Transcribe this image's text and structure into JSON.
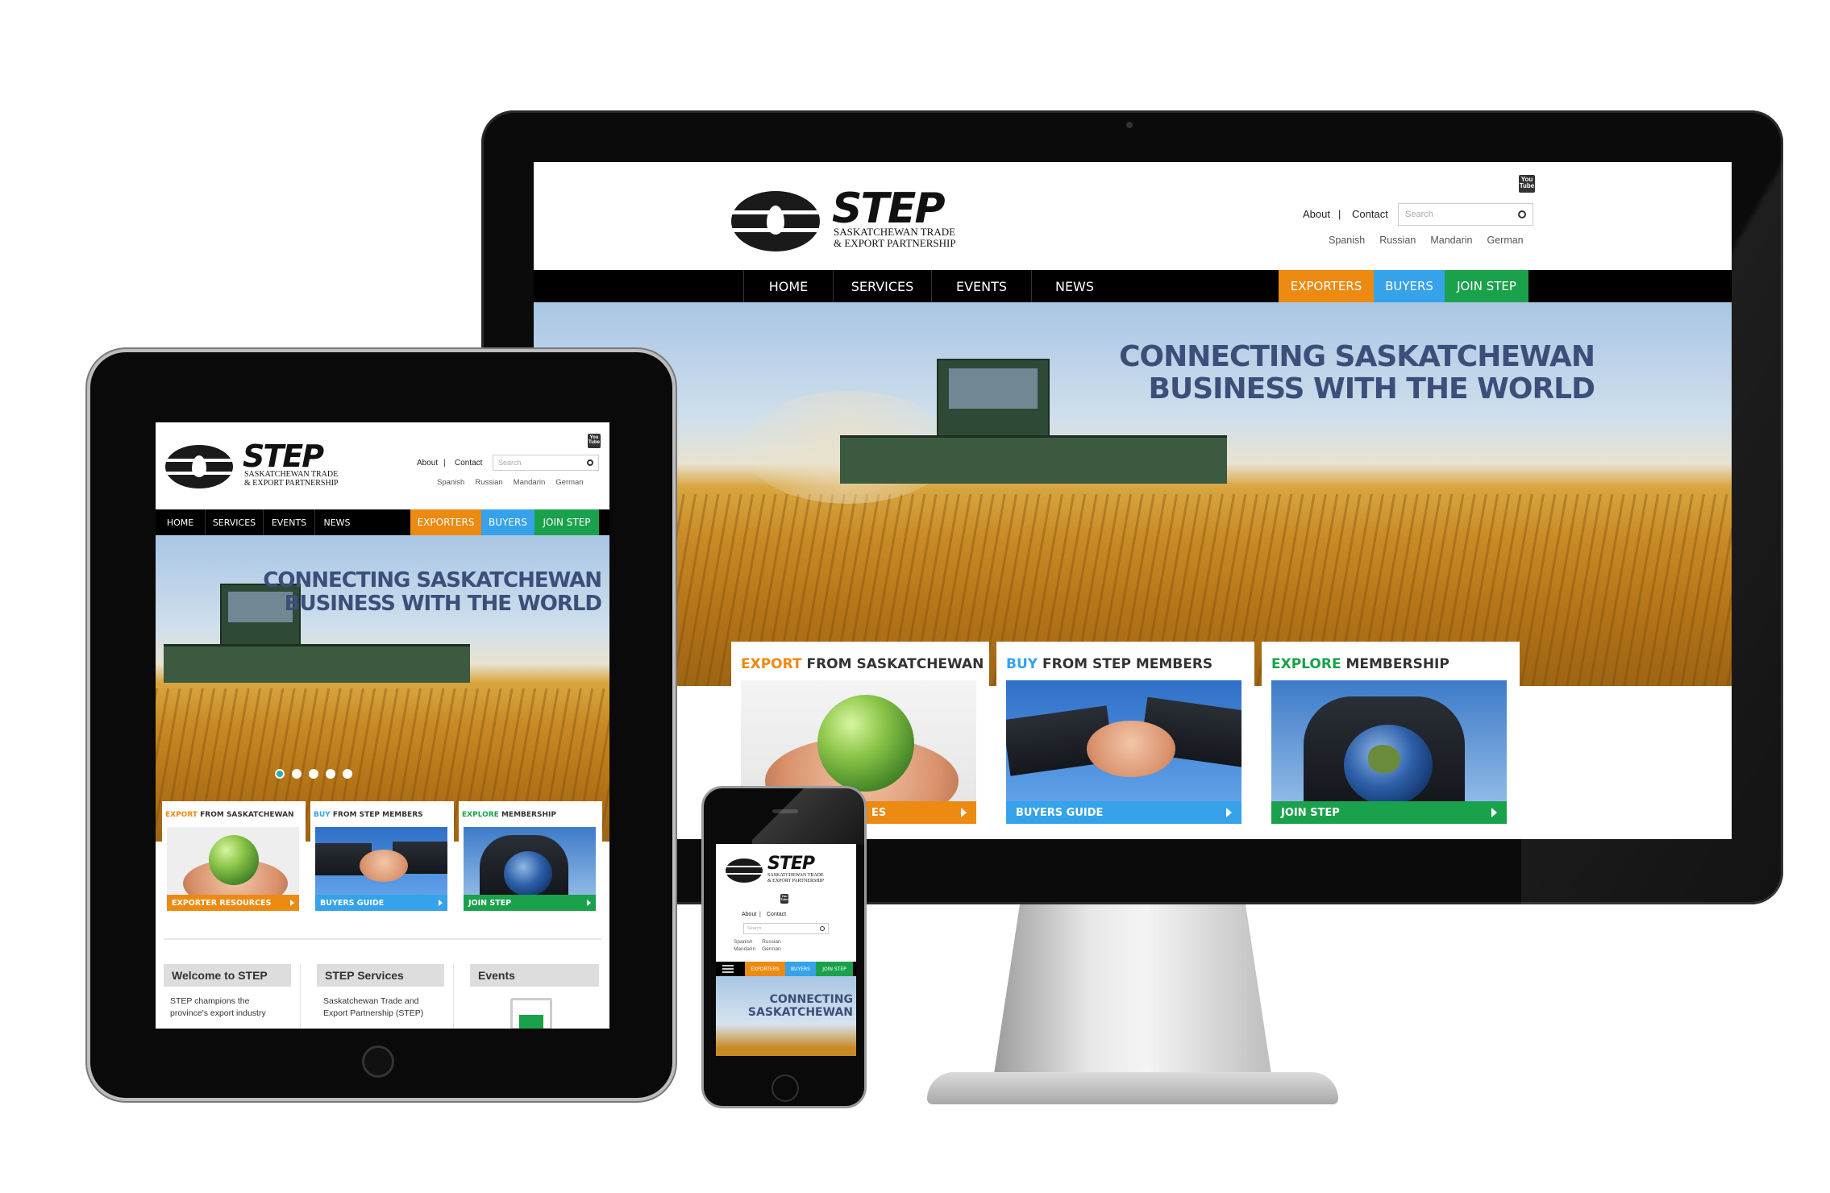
{
  "brand": {
    "name": "STEP",
    "line1": "SASKATCHEWAN TRADE",
    "line2": "& EXPORT PARTNERSHIP"
  },
  "top_links": {
    "about": "About",
    "sep": "|",
    "contact": "Contact"
  },
  "youtube": {
    "you": "You",
    "tube": "Tube"
  },
  "search": {
    "placeholder": "Search"
  },
  "languages": [
    "Spanish",
    "Russian",
    "Mandarin",
    "German"
  ],
  "nav": [
    "HOME",
    "SERVICES",
    "EVENTS",
    "NEWS"
  ],
  "cta": {
    "exporters": "EXPORTERS",
    "buyers": "BUYERS",
    "join": "JOIN STEP"
  },
  "hero": {
    "line1": "CONNECTING SASKATCHEWAN",
    "line2": "BUSINESS WITH THE WORLD"
  },
  "cards": [
    {
      "accent": "EXPORT",
      "rest": " FROM SASKATCHEWAN",
      "button": "EXPORTER RESOURCES",
      "button_partial": "ES",
      "color": "#ec8a12"
    },
    {
      "accent": "BUY",
      "rest": " FROM STEP MEMBERS",
      "button": "BUYERS GUIDE",
      "color": "#35a2ea"
    },
    {
      "accent": "EXPLORE",
      "rest": " MEMBERSHIP",
      "button": "JOIN STEP",
      "color": "#1aa14b"
    }
  ],
  "tablet_sections": [
    {
      "title": "Welcome to STEP",
      "text1": "STEP champions the",
      "text2": "province's export industry"
    },
    {
      "title": "STEP Services",
      "text1": "Saskatchewan Trade and",
      "text2": "Export Partnership (STEP)"
    },
    {
      "title": "Events",
      "text1": "",
      "text2": ""
    }
  ],
  "phone": {
    "hero1": "CONNECTING",
    "hero2": "SASKATCHEWAN"
  },
  "colors": {
    "orange": "#ec8a12",
    "blue": "#35a2ea",
    "green": "#1aa14b",
    "headline": "#3b4f7a"
  }
}
